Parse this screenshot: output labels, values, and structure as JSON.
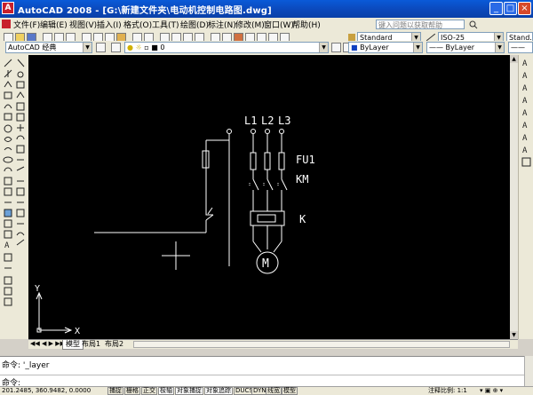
{
  "window": {
    "title": "AutoCAD 2008 - [G:\\新建文件夹\\电动机控制电路图.dwg]",
    "app_icon": "A"
  },
  "menu": [
    "文件(F)",
    "编辑(E)",
    "视图(V)",
    "插入(I)",
    "格式(O)",
    "工具(T)",
    "绘图(D)",
    "标注(N)",
    "修改(M)",
    "窗口(W)",
    "帮助(H)"
  ],
  "search_placeholder": "键入问题以获取帮助",
  "toolbar": {
    "workspace": "AutoCAD 经典",
    "text_style": "Standard",
    "dim_style": "ISO-25",
    "layer": "0",
    "color": "ByLayer",
    "linetype": "—— ByLayer",
    "extra_style": "Stand…"
  },
  "drawing": {
    "phase_labels": [
      "L1",
      "L2",
      "L3"
    ],
    "fuse_label": "FU1",
    "contactor_label": "KM",
    "coil_label": "K",
    "motor_label": "M",
    "ucs_x": "X",
    "ucs_y": "Y"
  },
  "tabs": [
    "模型",
    "布局1",
    "布局2"
  ],
  "command": {
    "line1": "命令: '_layer",
    "prompt": "命令:"
  },
  "status": {
    "coords": "201.2485, 360.9482, 0.0000",
    "buttons": [
      "捕捉",
      "栅格",
      "正交",
      "极轴",
      "对象捕捉",
      "对象追踪",
      "DUCS",
      "DYN",
      "线宽",
      "模型"
    ],
    "annotation_scale": "注释比例: 1:1"
  },
  "colors": {
    "canvas": "#000000",
    "titlebar": "#0b47b8",
    "drawing_line": "#ffffff"
  }
}
